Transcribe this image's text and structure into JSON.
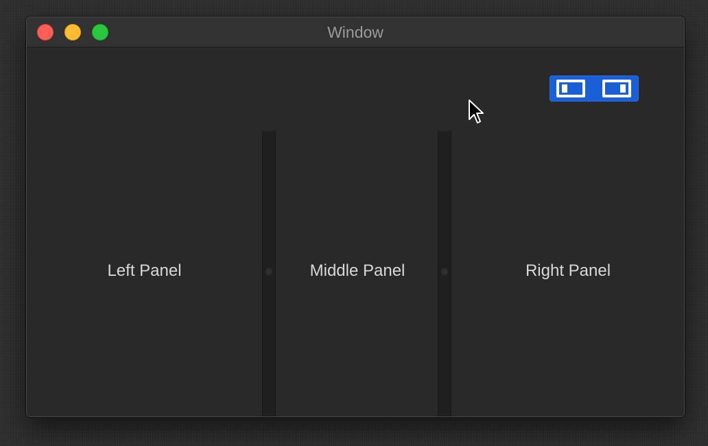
{
  "window": {
    "title": "Window",
    "controls": {
      "close_color": "#ff5f57",
      "minimize_color": "#febc2e",
      "zoom_color": "#28c840"
    }
  },
  "toolbar": {
    "toggle_group_color": "#1a5fd6",
    "buttons": [
      {
        "icon": "left-sidebar-icon"
      },
      {
        "icon": "right-sidebar-icon"
      }
    ]
  },
  "panels": {
    "left": {
      "label": "Left Panel"
    },
    "middle": {
      "label": "Middle Panel"
    },
    "right": {
      "label": "Right Panel"
    }
  },
  "cursor": {
    "icon": "arrow-pointer-icon"
  }
}
